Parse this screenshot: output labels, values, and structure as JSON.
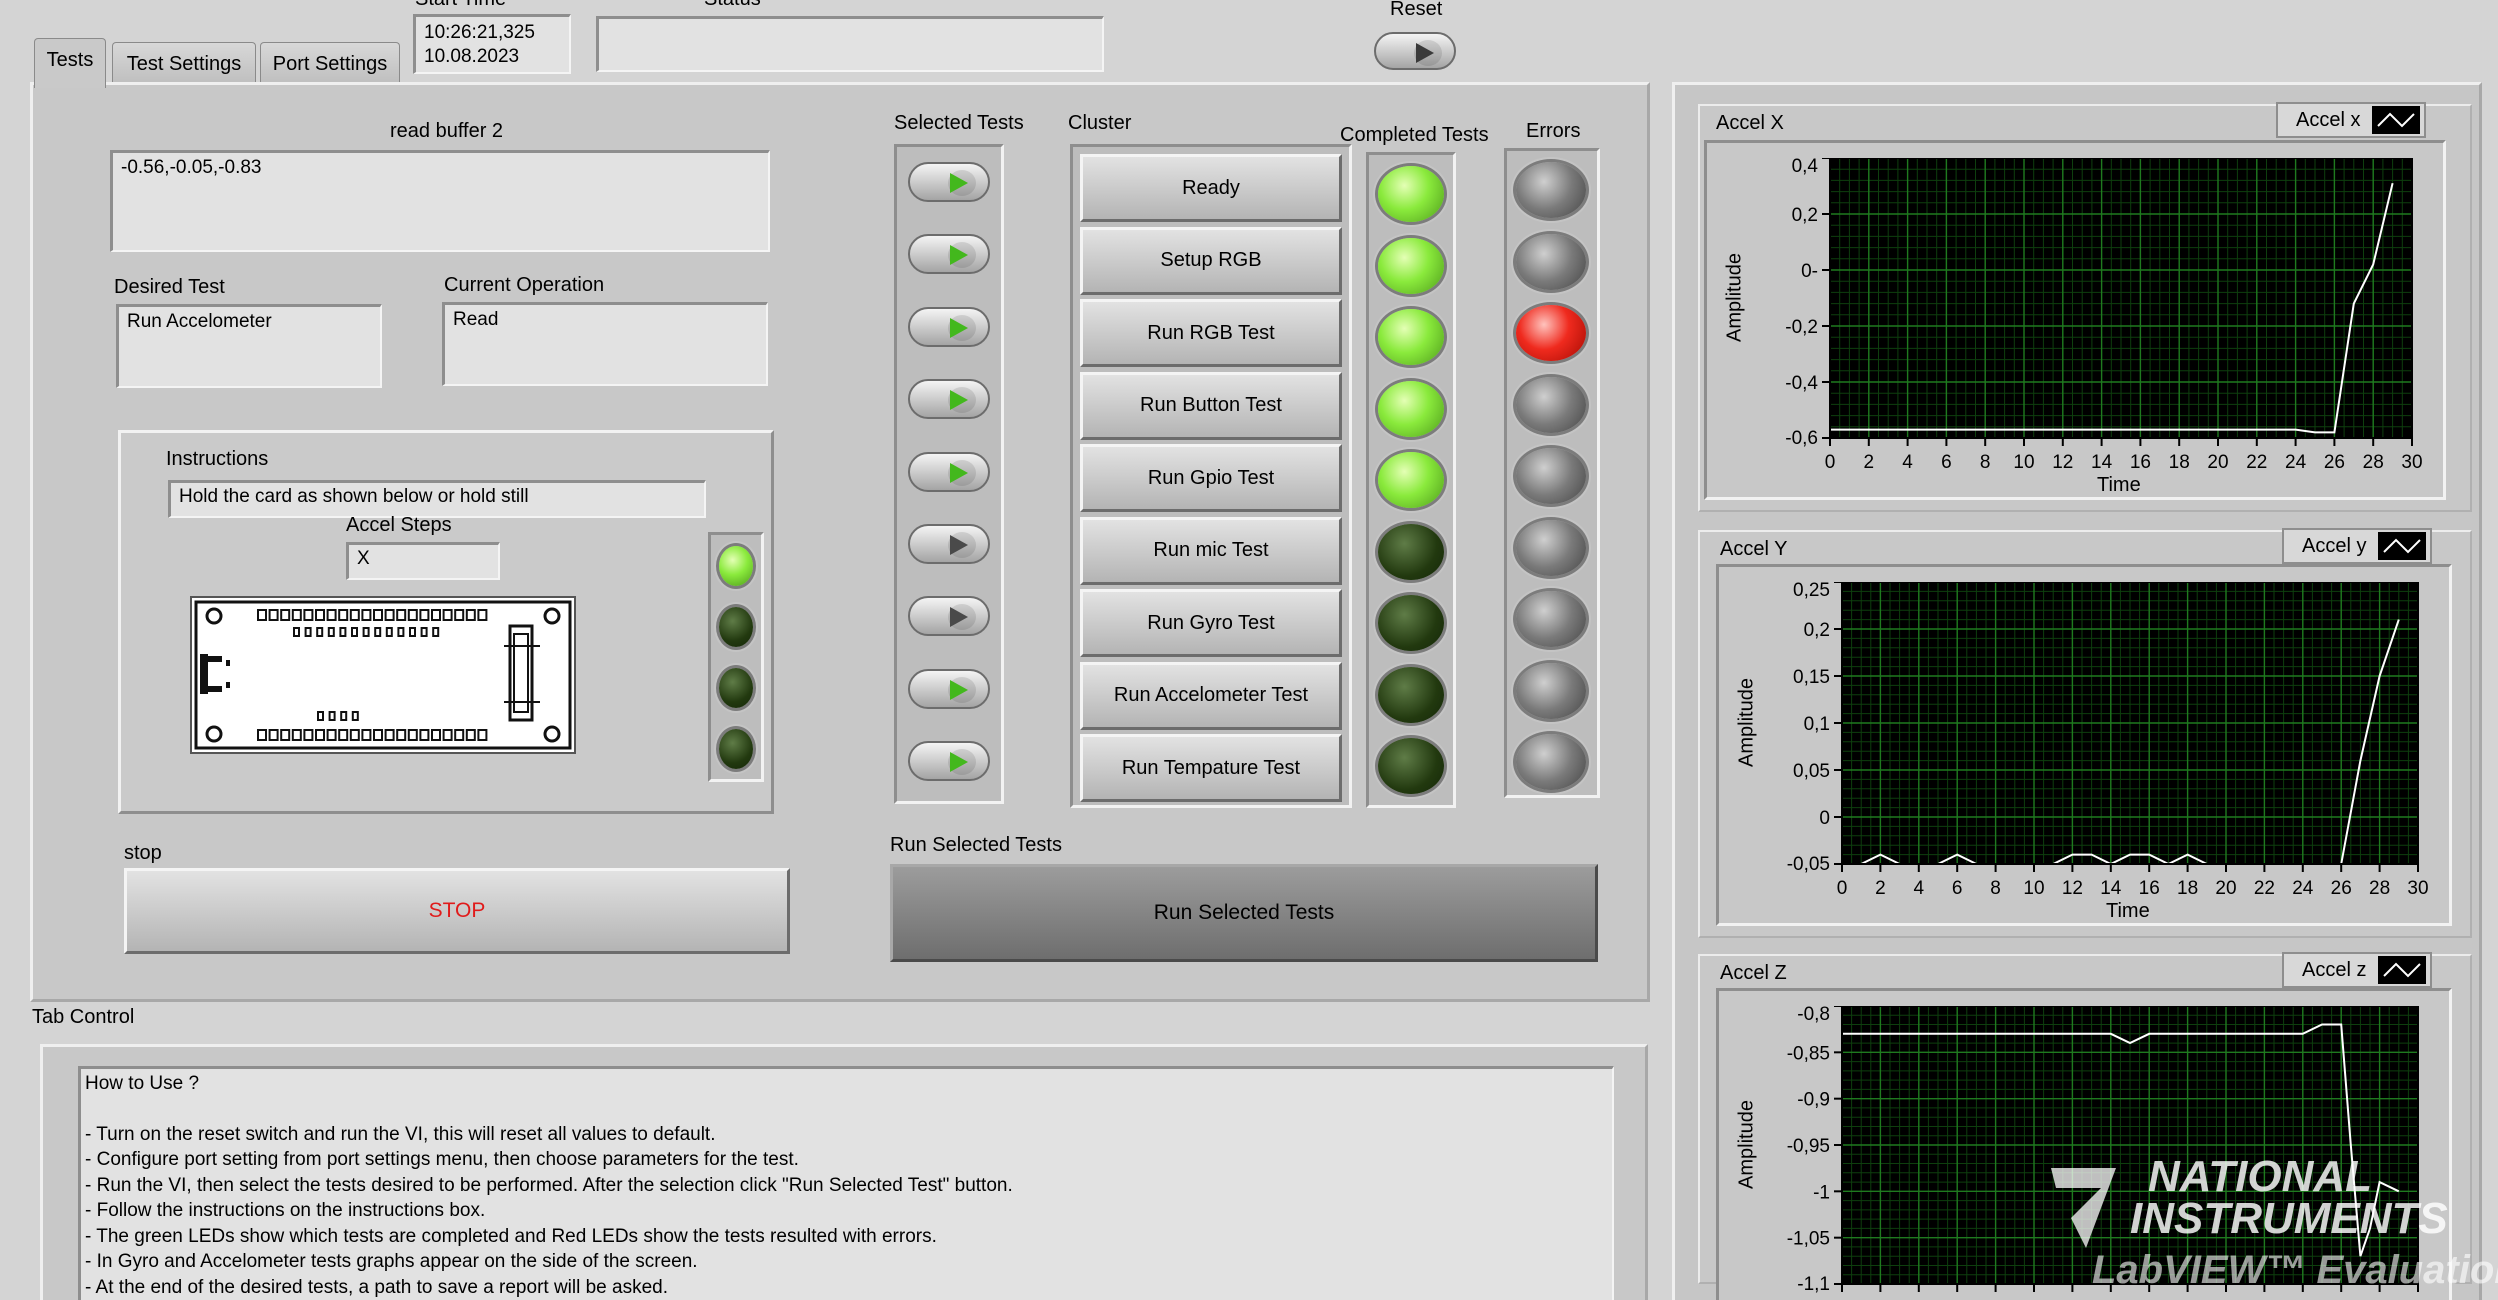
{
  "header": {
    "start_time_label": "Start Time",
    "start_time": "10:26:21,325",
    "start_date": "10.08.2023",
    "status_label": "Status",
    "status_value": "",
    "reset_label": "Reset"
  },
  "tabs": [
    {
      "label": "Tests"
    },
    {
      "label": "Test Settings"
    },
    {
      "label": "Port Settings"
    }
  ],
  "read_buffer": {
    "label": "read buffer 2",
    "value": "-0.56,-0.05,-0.83"
  },
  "desired_test": {
    "label": "Desired Test",
    "value": "Run Accelometer"
  },
  "current_operation": {
    "label": "Current Operation",
    "value": "Read"
  },
  "instructions": {
    "label": "Instructions",
    "text": "Hold the card as shown below or hold still",
    "accel_steps_label": "Accel Steps",
    "accel_steps_value": "X",
    "leds": [
      true,
      false,
      false,
      false
    ]
  },
  "stop": {
    "label": "stop",
    "button": "STOP",
    "color": "#e01b1b"
  },
  "selected_tests": {
    "label": "Selected Tests",
    "states": [
      true,
      true,
      true,
      true,
      true,
      false,
      false,
      true,
      true
    ]
  },
  "cluster": {
    "label": "Cluster",
    "items": [
      "Ready",
      "Setup RGB",
      "Run RGB Test",
      "Run Button Test",
      "Run Gpio Test",
      "Run mic Test",
      "Run Gyro Test",
      "Run Accelometer Test",
      "Run Tempature Test"
    ]
  },
  "completed_tests": {
    "label": "Completed Tests",
    "states": [
      true,
      true,
      true,
      true,
      true,
      false,
      false,
      false,
      false
    ]
  },
  "errors": {
    "label": "Errors",
    "states": [
      false,
      false,
      true,
      false,
      false,
      false,
      false,
      false,
      false
    ]
  },
  "run_selected": {
    "label": "Run Selected Tests",
    "button": "Run Selected Tests"
  },
  "tab_control_label": "Tab Control",
  "how_to": {
    "title": "How to Use ?",
    "lines": [
      "- Turn on the reset switch and run the VI, this will reset all values to default.",
      "- Configure port setting from port settings menu, then choose parameters for the test.",
      "- Run the VI, then select the tests desired to be performed. After the selection click \"Run Selected Test\" button.",
      "- Follow the instructions on the instructions box.",
      "- The green LEDs show which tests are completed and Red LEDs show the tests resulted with errors.",
      "- In Gyro and Accelometer tests graphs appear on the side of the screen.",
      "- At the end of the desired tests, a path to save a report will be asked."
    ]
  },
  "watermark": {
    "line1": "NATIONAL",
    "line2": "INSTRUMENTS",
    "line3": "LabVIEW™ Evaluation So"
  },
  "chart_data": [
    {
      "type": "line",
      "title": "Accel X",
      "legend": "Accel x",
      "xlabel": "Time",
      "ylabel": "Amplitude",
      "xlim": [
        0,
        30
      ],
      "ylim": [
        -0.6,
        0.4
      ],
      "xticks": [
        0,
        2,
        4,
        6,
        8,
        10,
        12,
        14,
        16,
        18,
        20,
        22,
        24,
        26,
        28,
        30
      ],
      "xtick_labels": [
        "0",
        "2",
        "4",
        "6",
        "8",
        "10",
        "12",
        "14",
        "16",
        "18",
        "20",
        "22",
        "24",
        "26",
        "28",
        "30"
      ],
      "yticks": [
        0.4,
        0.2,
        0,
        -0.2,
        -0.4,
        -0.6
      ],
      "ytick_labels": [
        "0,4",
        "0,2",
        "0-",
        "-0,2",
        "-0,4",
        "-0,6"
      ],
      "grid": true,
      "x": [
        0,
        2,
        4,
        6,
        8,
        10,
        12,
        14,
        16,
        18,
        20,
        22,
        24,
        25,
        26,
        27,
        28,
        29
      ],
      "y": [
        -0.57,
        -0.57,
        -0.57,
        -0.57,
        -0.57,
        -0.57,
        -0.57,
        -0.57,
        -0.57,
        -0.57,
        -0.57,
        -0.57,
        -0.57,
        -0.58,
        -0.58,
        -0.12,
        0.02,
        0.31
      ]
    },
    {
      "type": "line",
      "title": "Accel Y",
      "legend": "Accel y",
      "xlabel": "Time",
      "ylabel": "Amplitude",
      "xlim": [
        0,
        30
      ],
      "ylim": [
        -0.05,
        0.25
      ],
      "xticks": [
        0,
        2,
        4,
        6,
        8,
        10,
        12,
        14,
        16,
        18,
        20,
        22,
        24,
        26,
        28,
        30
      ],
      "xtick_labels": [
        "0",
        "2",
        "4",
        "6",
        "8",
        "10",
        "12",
        "14",
        "16",
        "18",
        "20",
        "22",
        "24",
        "26",
        "28",
        "30"
      ],
      "yticks": [
        0.25,
        0.2,
        0.15,
        0.1,
        0.05,
        0,
        -0.05
      ],
      "ytick_labels": [
        "0,25",
        "0,2",
        "0,15",
        "0,1",
        "0,05",
        "0",
        "-0,05"
      ],
      "grid": true,
      "x": [
        0,
        1,
        2,
        3,
        4,
        5,
        6,
        7,
        8,
        9,
        10,
        11,
        12,
        13,
        14,
        15,
        16,
        17,
        18,
        19,
        20,
        21,
        22,
        23,
        24,
        25,
        26,
        27,
        28,
        29
      ],
      "y": [
        -0.05,
        -0.05,
        -0.04,
        -0.05,
        -0.05,
        -0.05,
        -0.04,
        -0.05,
        -0.05,
        -0.05,
        -0.05,
        -0.05,
        -0.04,
        -0.04,
        -0.05,
        -0.04,
        -0.04,
        -0.05,
        -0.04,
        -0.05,
        -0.05,
        -0.05,
        -0.05,
        -0.05,
        -0.05,
        -0.05,
        -0.05,
        0.06,
        0.15,
        0.21
      ]
    },
    {
      "type": "line",
      "title": "Accel Z",
      "legend": "Accel z",
      "xlabel": "",
      "ylabel": "Amplitude",
      "xlim": [
        0,
        30
      ],
      "ylim": [
        -1.1,
        -0.8
      ],
      "xticks": [
        0,
        2,
        4,
        6,
        8,
        10,
        12,
        14,
        16,
        18,
        20,
        22,
        24,
        26,
        28,
        30
      ],
      "xtick_labels": [],
      "yticks": [
        -0.8,
        -0.85,
        -0.9,
        -0.95,
        -1,
        -1.05,
        -1.1
      ],
      "ytick_labels": [
        "-0,8",
        "-0,85",
        "-0,9",
        "-0,95",
        "-1",
        "-1,05",
        "-1,1"
      ],
      "grid": true,
      "x": [
        0,
        2,
        4,
        6,
        8,
        10,
        12,
        14,
        15,
        16,
        18,
        20,
        22,
        24,
        25,
        26,
        26.5,
        27,
        27.5,
        28,
        29
      ],
      "y": [
        -0.83,
        -0.83,
        -0.83,
        -0.83,
        -0.83,
        -0.83,
        -0.83,
        -0.83,
        -0.84,
        -0.83,
        -0.83,
        -0.83,
        -0.83,
        -0.83,
        -0.82,
        -0.82,
        -0.95,
        -1.07,
        -1.04,
        -0.99,
        -1.0
      ]
    }
  ]
}
